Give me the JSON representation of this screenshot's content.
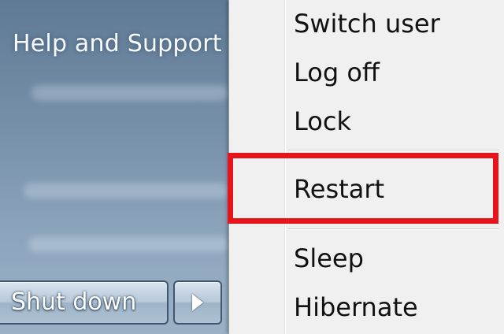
{
  "start_panel": {
    "help_label": "Help and Support"
  },
  "shutdown": {
    "button_label": "Shut down",
    "arrow_icon": "chevron-right-icon"
  },
  "power_menu": {
    "items": [
      {
        "label": "Switch user"
      },
      {
        "label": "Log off"
      },
      {
        "label": "Lock"
      },
      {
        "label": "Restart"
      },
      {
        "label": "Sleep"
      },
      {
        "label": "Hibernate"
      }
    ],
    "highlighted_item": "Restart",
    "highlight_color": "#e8141c"
  }
}
